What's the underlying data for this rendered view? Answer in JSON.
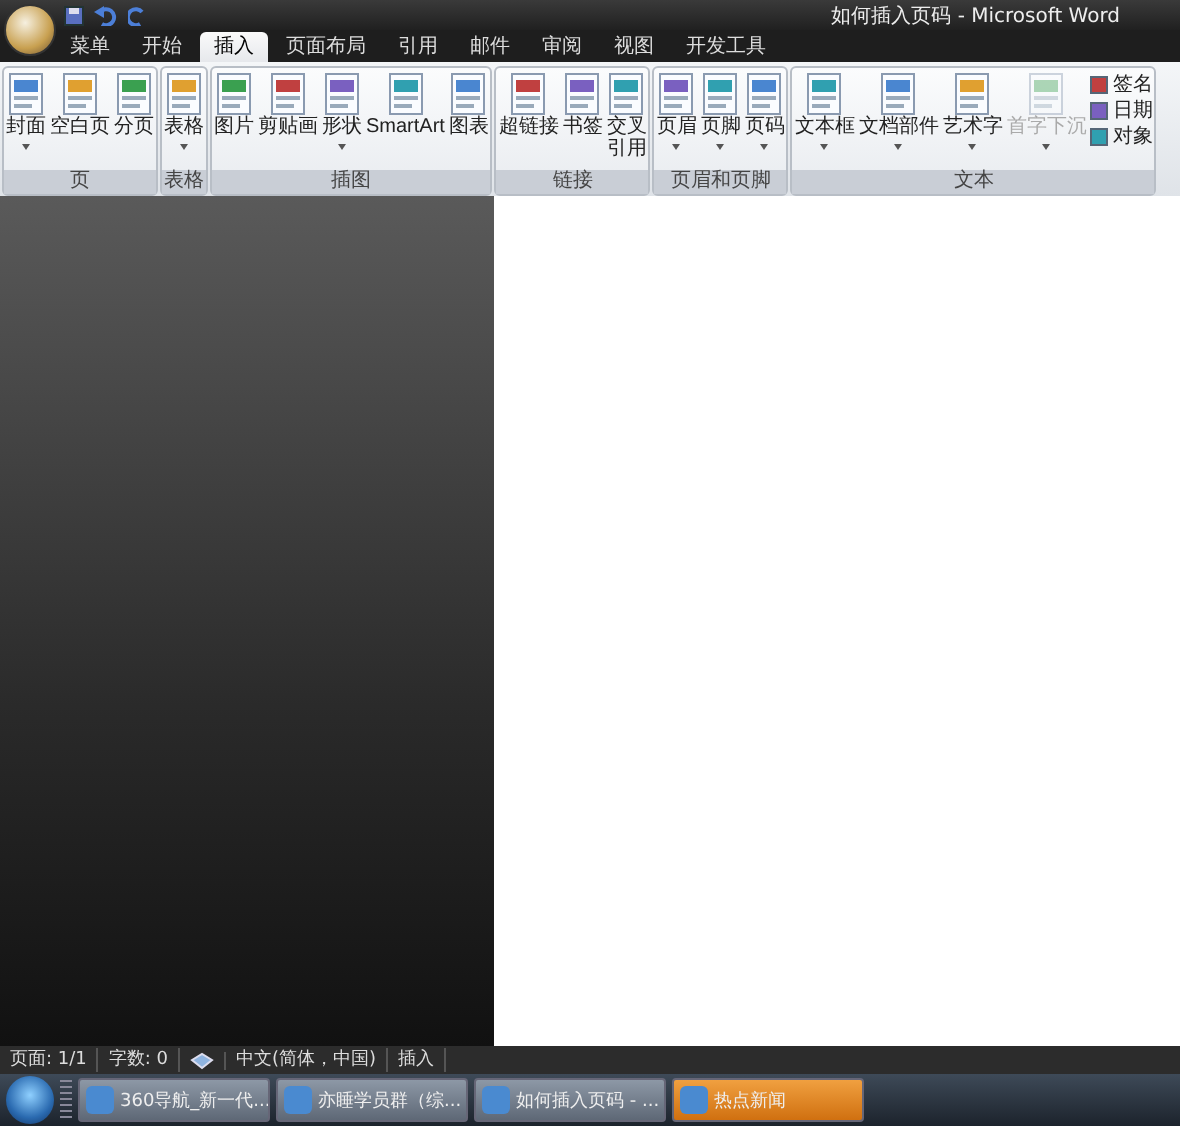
{
  "window": {
    "title": "如何插入页码 - Microsoft Word"
  },
  "tabs": [
    {
      "label": "菜单",
      "selected": false
    },
    {
      "label": "开始",
      "selected": false
    },
    {
      "label": "插入",
      "selected": true
    },
    {
      "label": "页面布局",
      "selected": false
    },
    {
      "label": "引用",
      "selected": false
    },
    {
      "label": "邮件",
      "selected": false
    },
    {
      "label": "审阅",
      "selected": false
    },
    {
      "label": "视图",
      "selected": false
    },
    {
      "label": "开发工具",
      "selected": false
    }
  ],
  "ribbon_groups": [
    {
      "label": "页",
      "buttons": [
        {
          "kind": "large",
          "label": "封面",
          "dropdown": true,
          "disabled": false
        },
        {
          "kind": "large",
          "label": "空白页",
          "dropdown": false,
          "disabled": false
        },
        {
          "kind": "large",
          "label": "分页",
          "dropdown": false,
          "disabled": false
        }
      ]
    },
    {
      "label": "表格",
      "buttons": [
        {
          "kind": "large",
          "label": "表格",
          "dropdown": true,
          "disabled": false
        }
      ]
    },
    {
      "label": "插图",
      "buttons": [
        {
          "kind": "large",
          "label": "图片",
          "dropdown": false,
          "disabled": false
        },
        {
          "kind": "large",
          "label": "剪贴画",
          "dropdown": false,
          "disabled": false
        },
        {
          "kind": "large",
          "label": "形状",
          "dropdown": true,
          "disabled": false
        },
        {
          "kind": "large",
          "label": "SmartArt",
          "dropdown": false,
          "disabled": false
        },
        {
          "kind": "large",
          "label": "图表",
          "dropdown": false,
          "disabled": false
        }
      ]
    },
    {
      "label": "链接",
      "buttons": [
        {
          "kind": "large",
          "label": "超链接",
          "dropdown": false,
          "disabled": false
        },
        {
          "kind": "large",
          "label": "书签",
          "dropdown": false,
          "disabled": false
        },
        {
          "kind": "tall",
          "label": "交叉引用",
          "dropdown": false,
          "disabled": false
        }
      ]
    },
    {
      "label": "页眉和页脚",
      "buttons": [
        {
          "kind": "large",
          "label": "页眉",
          "dropdown": true,
          "disabled": false
        },
        {
          "kind": "large",
          "label": "页脚",
          "dropdown": true,
          "disabled": false
        },
        {
          "kind": "large",
          "label": "页码",
          "dropdown": true,
          "disabled": false
        }
      ]
    },
    {
      "label": "文本",
      "buttons": [
        {
          "kind": "large",
          "label": "文本框",
          "dropdown": true,
          "disabled": false
        },
        {
          "kind": "large",
          "label": "文档部件",
          "dropdown": true,
          "disabled": false
        },
        {
          "kind": "large",
          "label": "艺术字",
          "dropdown": true,
          "disabled": false
        },
        {
          "kind": "large",
          "label": "首字下沉",
          "dropdown": true,
          "disabled": true
        },
        {
          "kind": "small",
          "label": "签名"
        },
        {
          "kind": "small",
          "label": "日期"
        },
        {
          "kind": "small",
          "label": "对象"
        }
      ]
    }
  ],
  "status_bar": {
    "page": "页面: 1/1",
    "words": "字数: 0",
    "language": "中文(简体，中国)",
    "mode": "插入"
  },
  "taskbar": [
    {
      "label": "360导航_新一代...",
      "highlighted": false
    },
    {
      "label": "亦睡学员群（综...",
      "highlighted": false
    },
    {
      "label": "如何插入页码 - ...",
      "highlighted": false
    },
    {
      "label": "热点新闻",
      "highlighted": true
    }
  ]
}
